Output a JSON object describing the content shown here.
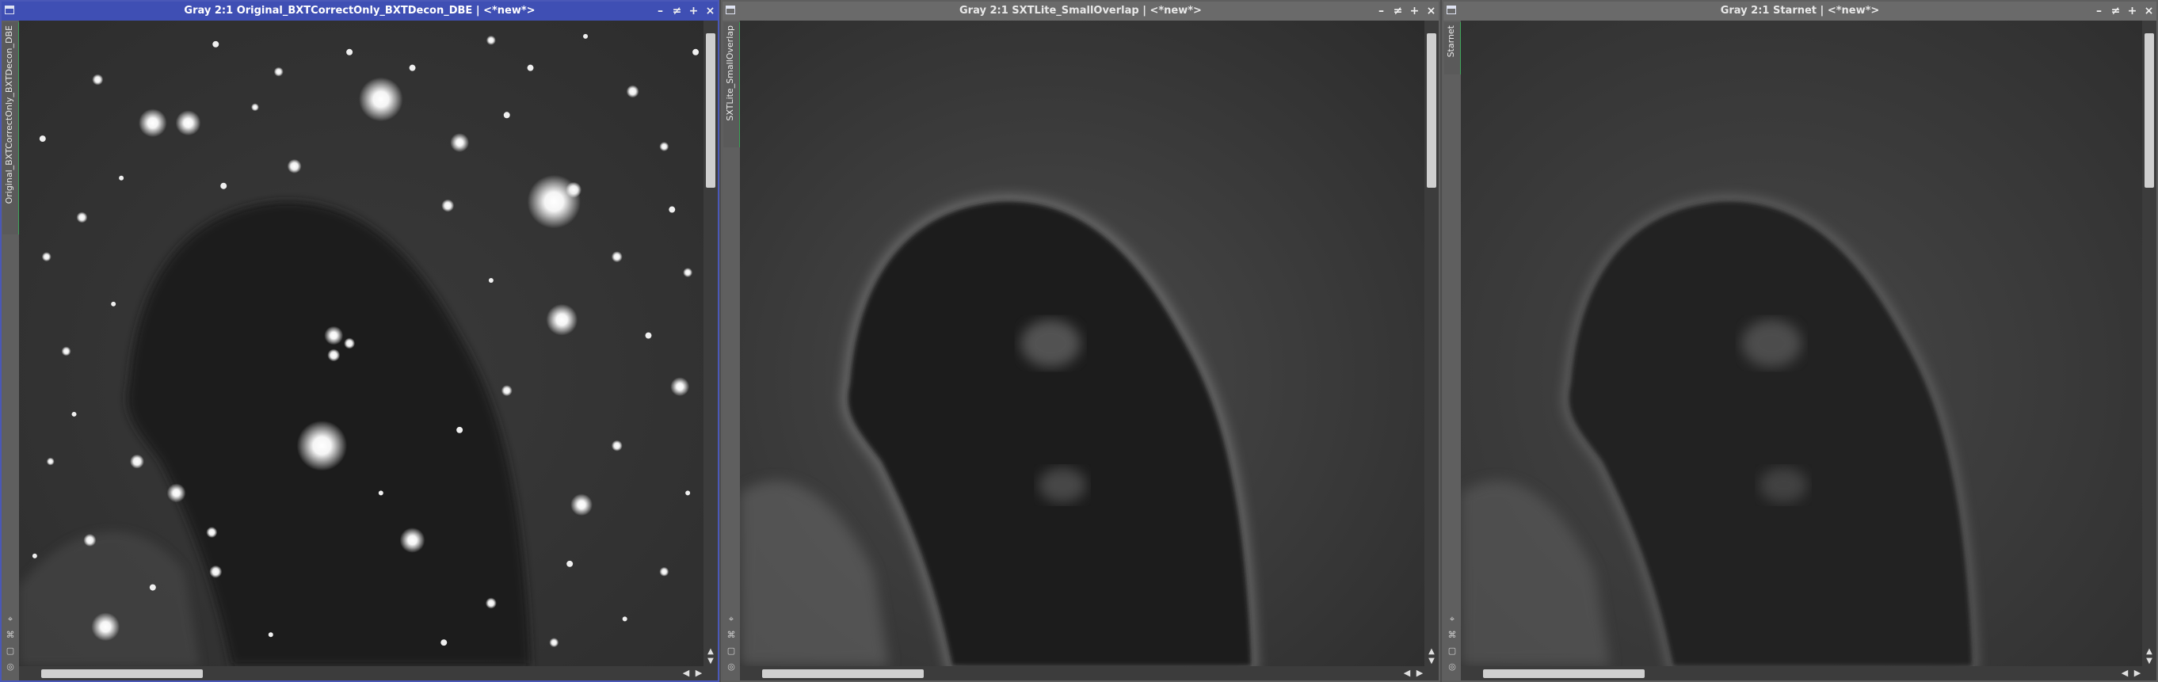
{
  "windows": [
    {
      "id": "original",
      "title": "Gray 2:1 Original_BXTCorrectOnly_BXTDecon_DBE | <*new*>",
      "side_tab": "Original_BXTCorrectOnly_BXTDecon_DBE",
      "active": true,
      "image_content": "nebula-with-stars"
    },
    {
      "id": "sxtlite",
      "title": "Gray 2:1 SXTLite_SmallOverlap | <*new*>",
      "side_tab": "SXTLite_SmallOverlap",
      "active": false,
      "image_content": "starless-nebula"
    },
    {
      "id": "starnet",
      "title": "Gray 2:1 Starnet | <*new*>",
      "side_tab": "Starnet",
      "active": false,
      "image_content": "starless-nebula"
    }
  ],
  "titlebar_buttons": {
    "minimize": "–",
    "shade": "≠",
    "maximize": "+",
    "close": "×"
  },
  "icons": {
    "window_icon": "window-icon",
    "side_icons": [
      "pin-icon",
      "link-icon",
      "lock-icon",
      "settings-icon"
    ],
    "scroll_arrows": [
      "scroll-up-icon",
      "scroll-down-icon",
      "scroll-left-icon",
      "scroll-right-icon"
    ]
  },
  "colors": {
    "active_titlebar": "#3f4fb4",
    "inactive_titlebar": "#6a6a6a",
    "side_tab_marker": "#3fa45a",
    "workspace_bg": "#4d4d4d"
  }
}
